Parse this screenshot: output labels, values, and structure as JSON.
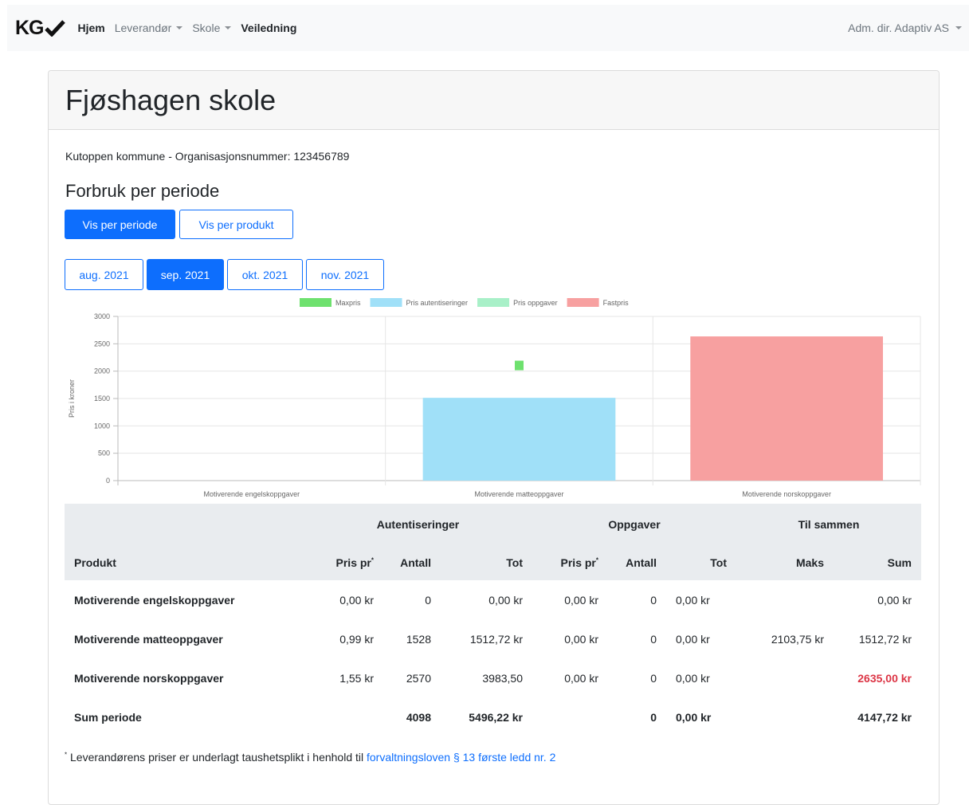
{
  "nav": {
    "brand": "KG",
    "items": [
      {
        "label": "Hjem",
        "active": true,
        "dropdown": false
      },
      {
        "label": "Leverandør",
        "active": false,
        "dropdown": true
      },
      {
        "label": "Skole",
        "active": false,
        "dropdown": true
      },
      {
        "label": "Veiledning",
        "active": true,
        "dropdown": false
      }
    ],
    "user": "Adm. dir. Adaptiv AS"
  },
  "page": {
    "title": "Fjøshagen skole",
    "org_line": "Kutoppen kommune - Organisasjonsnummer: 123456789",
    "section_title": "Forbruk per periode",
    "view_buttons": [
      "Vis per periode",
      "Vis per produkt"
    ],
    "periods": [
      "aug. 2021",
      "sep. 2021",
      "okt. 2021",
      "nov. 2021"
    ],
    "selected_period": "sep. 2021"
  },
  "chart_data": {
    "type": "bar",
    "categories": [
      "Motiverende engelskoppgaver",
      "Motiverende matteoppgaver",
      "Motiverende norskoppgaver"
    ],
    "series": [
      {
        "name": "Maxpris",
        "values": [
          null,
          2103.75,
          null
        ],
        "color": "#6ee16e"
      },
      {
        "name": "Pris autentiseringer",
        "values": [
          0,
          1512.72,
          0
        ],
        "color": "#a0e0f8"
      },
      {
        "name": "Pris oppgaver",
        "values": [
          0,
          0,
          0
        ],
        "color": "#a8f0c8"
      },
      {
        "name": "Fastpris",
        "values": [
          0,
          0,
          2635.0
        ],
        "color": "#f7a0a0"
      }
    ],
    "ylabel": "Pris i kroner",
    "ylim": [
      0,
      3000
    ],
    "yticks": [
      "0",
      "500",
      "1000",
      "1500",
      "2000",
      "2500",
      "3000"
    ],
    "legend": "top",
    "grid": true
  },
  "table": {
    "groups": [
      "Autentiseringer",
      "Oppgaver",
      "Til sammen"
    ],
    "headers": {
      "produkt": "Produkt",
      "pris_pr": "Pris pr",
      "antall": "Antall",
      "tot": "Tot",
      "maks": "Maks",
      "sum": "Sum",
      "footnote_mark": "*"
    },
    "rows": [
      {
        "produkt": "Motiverende engelskoppgaver",
        "a_pris": "0,00 kr",
        "a_antall": "0",
        "a_tot": "0,00 kr",
        "o_pris": "0,00 kr",
        "o_antall": "0",
        "o_tot": "0,00 kr",
        "maks": "",
        "sum": "0,00 kr",
        "sum_red": false
      },
      {
        "produkt": "Motiverende matteoppgaver",
        "a_pris": "0,99 kr",
        "a_antall": "1528",
        "a_tot": "1512,72 kr",
        "o_pris": "0,00 kr",
        "o_antall": "0",
        "o_tot": "0,00 kr",
        "maks": "2103,75 kr",
        "sum": "1512,72 kr",
        "sum_red": false
      },
      {
        "produkt": "Motiverende norskoppgaver",
        "a_pris": "1,55 kr",
        "a_antall": "2570",
        "a_tot": "3983,50",
        "o_pris": "0,00 kr",
        "o_antall": "0",
        "o_tot": "0,00 kr",
        "maks": "",
        "sum": "2635,00 kr",
        "sum_red": true
      }
    ],
    "sum_row": {
      "label": "Sum periode",
      "a_antall": "4098",
      "a_tot": "5496,22 kr",
      "o_antall": "0",
      "o_tot": "0,00 kr",
      "sum": "4147,72 kr"
    }
  },
  "footnote": {
    "mark": "*",
    "text": " Leverandørens priser er underlagt taushetsplikt i henhold til ",
    "link": "forvaltningsloven § 13 første ledd nr. 2"
  }
}
